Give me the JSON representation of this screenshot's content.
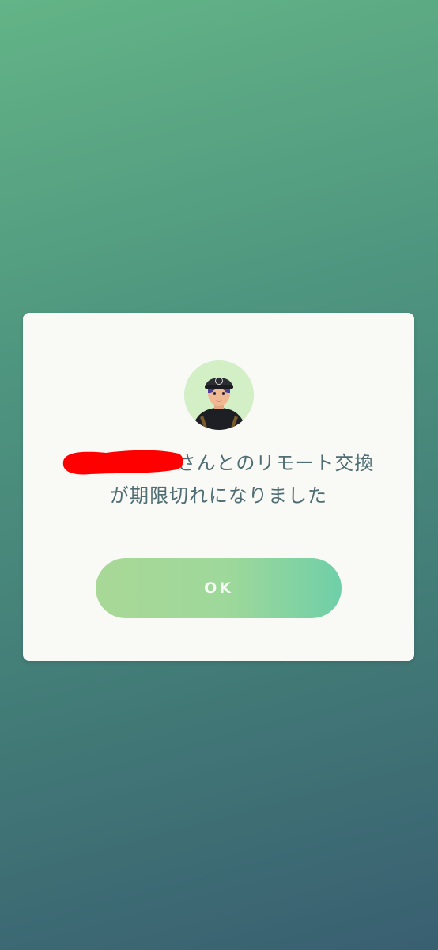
{
  "dialog": {
    "message_line1_suffix": "さんとのリモート交換",
    "message_line2": "が期限切れになりました",
    "ok_label": "OK"
  },
  "colors": {
    "background_top": "#63b487",
    "background_bottom": "#395f71",
    "dialog_bg": "#f9faf6",
    "message_text": "#4f6d73",
    "button_start": "#a9d897",
    "button_end": "#6fcfa8",
    "redaction": "#ff0000"
  }
}
